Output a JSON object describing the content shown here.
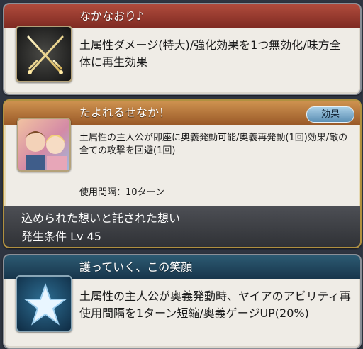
{
  "skills": [
    {
      "name": "なかなおり♪",
      "description": "土属性ダメージ(特大)/強化効果を1つ無効化/味方全体に再生効果",
      "icon": "crossed-swords-icon"
    },
    {
      "name": "たよれるせなか！",
      "badge": "効果",
      "description": "土属性の主人公が即座に奥義発動可能/奥義再発動(1回)効果/敵の全ての攻撃を回避(1回)",
      "cooldown": "使用間隔：10ターン",
      "icon": "character-portrait-icon",
      "ougi_name": "込められた想いと託された想い",
      "ougi_condition": "発生条件 Lv 45"
    },
    {
      "name": "護っていく、この笑顔",
      "description": "土属性の主人公が奥義発動時、ヤイアのアビリティ再使用間隔を1ターン短縮/奥義ゲージUP(20%)",
      "icon": "star-icon"
    }
  ],
  "colors": {
    "header_red": "#a0402f",
    "header_orange": "#c0813f",
    "header_blue": "#224a63",
    "badge_blue": "#7fb0d2"
  }
}
